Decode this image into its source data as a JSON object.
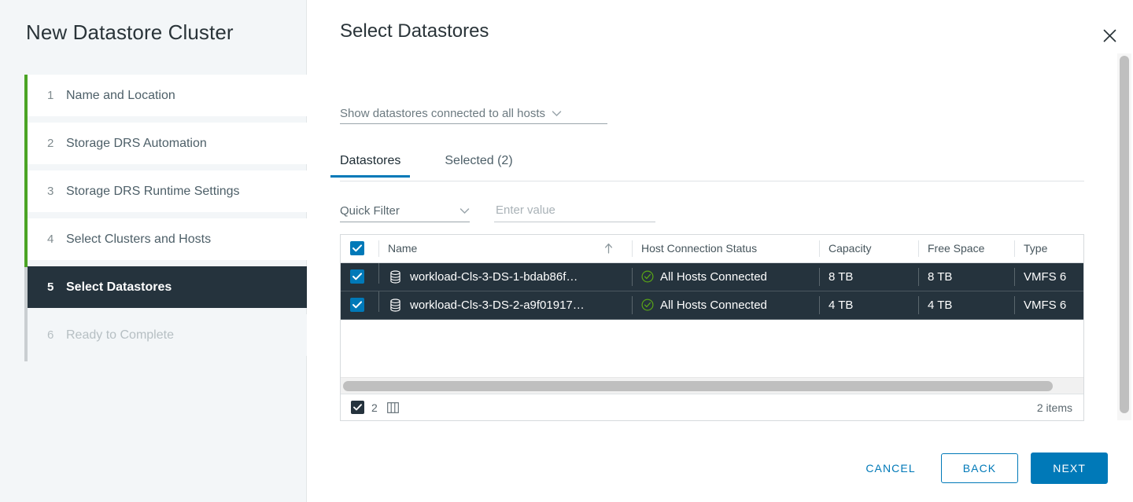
{
  "wizard": {
    "title": "New Datastore Cluster",
    "steps": [
      {
        "num": "1",
        "label": "Name and Location",
        "state": "done"
      },
      {
        "num": "2",
        "label": "Storage DRS Automation",
        "state": "done"
      },
      {
        "num": "3",
        "label": "Storage DRS Runtime Settings",
        "state": "done"
      },
      {
        "num": "4",
        "label": "Select Clusters and Hosts",
        "state": "done"
      },
      {
        "num": "5",
        "label": "Select Datastores",
        "state": "active"
      },
      {
        "num": "6",
        "label": "Ready to Complete",
        "state": "future"
      }
    ]
  },
  "page": {
    "title": "Select Datastores",
    "close_icon": "close-icon"
  },
  "scope": {
    "selected": "Show datastores connected to all hosts",
    "caret_icon": "chevron-down-icon"
  },
  "tabs": [
    {
      "label": "Datastores",
      "active": true
    },
    {
      "label": "Selected (2)",
      "active": false
    }
  ],
  "filter": {
    "quick_filter_label": "Quick Filter",
    "quick_filter_caret": "chevron-down-icon",
    "value": "",
    "placeholder": "Enter value"
  },
  "table": {
    "select_all_checked": true,
    "sort_column": "Name",
    "sort_direction": "ascending",
    "sort_icon": "arrow-up-icon",
    "columns": [
      "Name",
      "Host Connection Status",
      "Capacity",
      "Free Space",
      "Type"
    ],
    "rows": [
      {
        "checked": true,
        "icon": "datastore-icon",
        "name": "workload-Cls-3-DS-1-bdab86f…",
        "status_icon": "check-circle-icon",
        "status": "All Hosts Connected",
        "capacity": "8 TB",
        "free_space": "8 TB",
        "type": "VMFS 6"
      },
      {
        "checked": true,
        "icon": "datastore-icon",
        "name": "workload-Cls-3-DS-2-a9f01917…",
        "status_icon": "check-circle-icon",
        "status": "All Hosts Connected",
        "capacity": "4 TB",
        "free_space": "4 TB",
        "type": "VMFS 6"
      }
    ],
    "footer": {
      "selected_count": "2",
      "columns_icon": "columns-icon",
      "items_count": "2 items"
    }
  },
  "actions": {
    "cancel": "CANCEL",
    "back": "BACK",
    "next": "NEXT"
  },
  "colors": {
    "accent_blue": "#0079b8",
    "selected_row": "#25333d",
    "progress_green": "#4aa424",
    "status_green": "#5aa616",
    "sidebar_bg": "#f3f6f8"
  }
}
